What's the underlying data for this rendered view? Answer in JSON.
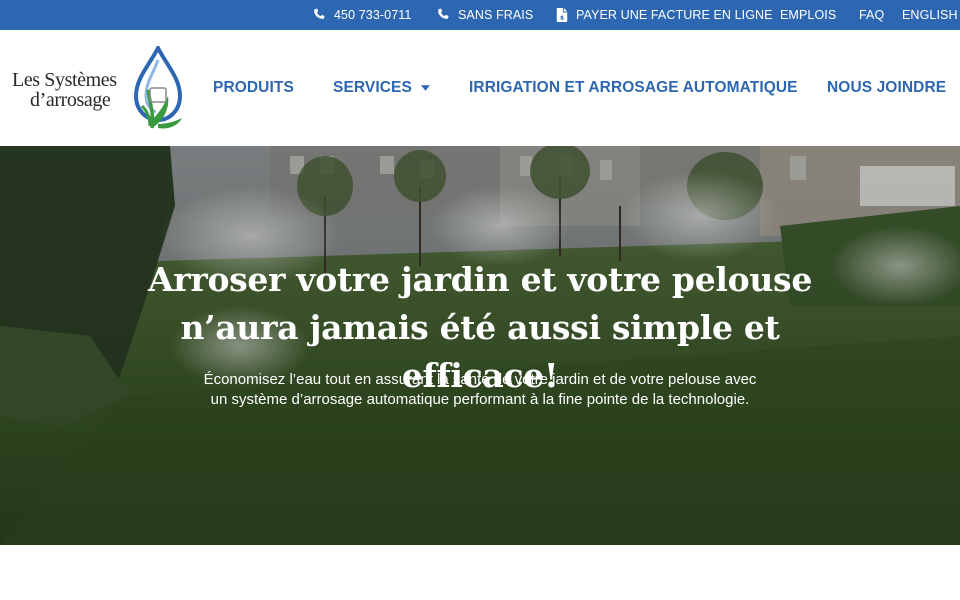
{
  "topbar": {
    "phone_local": "450 733-0711",
    "phone_tollfree": "SANS FRAIS",
    "pay_bill": "PAYER UNE FACTURE EN LIGNE",
    "jobs": "EMPLOIS",
    "faq": "FAQ",
    "language": "ENGLISH",
    "icons": [
      "phone-icon",
      "phone-icon",
      "file-invoice-dollar-icon"
    ]
  },
  "logo": {
    "line1": "Les Systèmes",
    "line2": "d’arrosage"
  },
  "nav": {
    "produits": "PRODUITS",
    "services": "SERVICES",
    "irrigation": "IRRIGATION ET ARROSAGE AUTOMATIQUE",
    "contact": "NOUS JOINDRE"
  },
  "hero": {
    "title_line1": "Arroser votre jardin et votre pelouse",
    "title_line2": "n’aura jamais été aussi simple et efficace!",
    "subtitle_line1": "Économisez l’eau tout en assurant la santé de votre jardin et de votre pelouse avec",
    "subtitle_line2": "un système d’arrosage automatique performant à la fine pointe de la technologie."
  },
  "colors": {
    "brand_blue": "#2d67b1",
    "logo_green": "#3a9a3f",
    "white": "#ffffff"
  }
}
